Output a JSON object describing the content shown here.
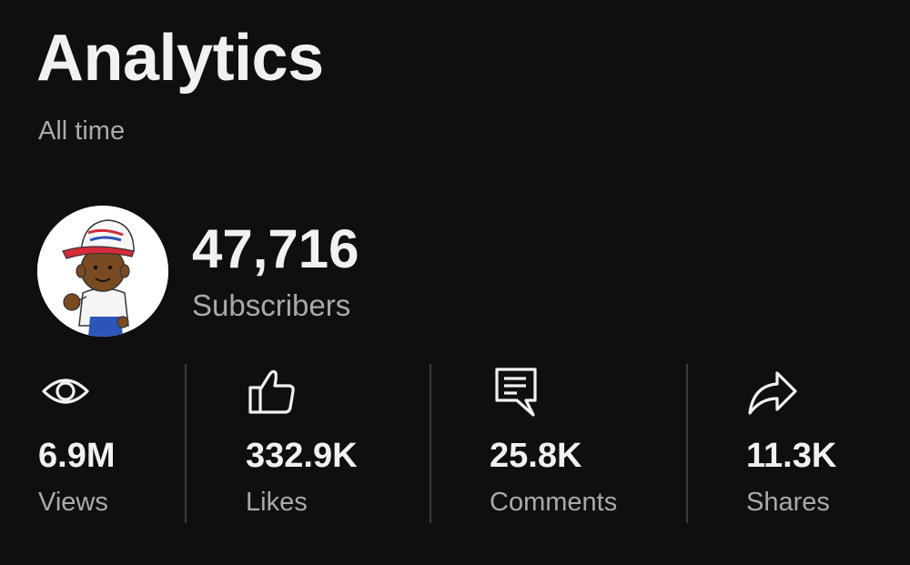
{
  "header": {
    "title": "Analytics",
    "period": "All time"
  },
  "channel": {
    "avatar_icon": "cartoon-kid-avatar",
    "subscriber_count": "47,716",
    "subscriber_label": "Subscribers"
  },
  "stats": [
    {
      "icon": "eye-icon",
      "value": "6.9M",
      "label": "Views"
    },
    {
      "icon": "thumbs-up-icon",
      "value": "332.9K",
      "label": "Likes"
    },
    {
      "icon": "comment-icon",
      "value": "25.8K",
      "label": "Comments"
    },
    {
      "icon": "share-icon",
      "value": "11.3K",
      "label": "Shares"
    }
  ],
  "colors": {
    "background": "#0f0f0f",
    "primary_text": "#f1f1f1",
    "secondary_text": "#aaaaaa",
    "divider": "#3a3a3a"
  }
}
